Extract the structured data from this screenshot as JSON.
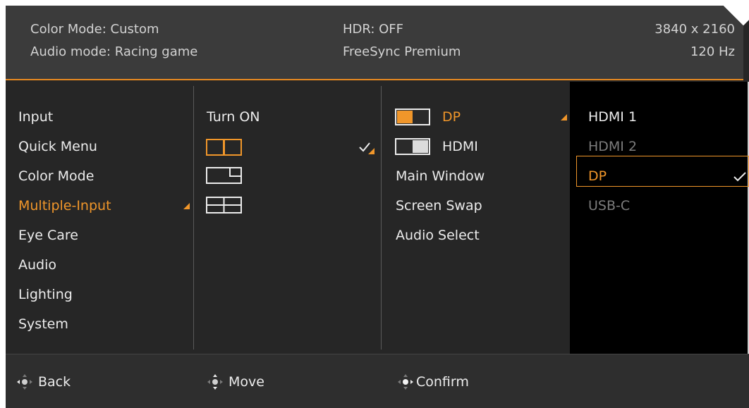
{
  "header": {
    "color_mode": "Color Mode: Custom",
    "audio_mode": "Audio mode: Racing game",
    "hdr": "HDR: OFF",
    "freesync": "FreeSync Premium",
    "resolution": "3840 x 2160",
    "refresh_rate": "120 Hz"
  },
  "menu": {
    "items": [
      {
        "label": "Input"
      },
      {
        "label": "Quick Menu"
      },
      {
        "label": "Color Mode"
      },
      {
        "label": "Multiple-Input",
        "selected": true
      },
      {
        "label": "Eye Care"
      },
      {
        "label": "Audio"
      },
      {
        "label": "Lighting"
      },
      {
        "label": "System"
      }
    ]
  },
  "multi_input": {
    "turn_on_label": "Turn ON",
    "layouts": [
      "pbp-side-by-side-icon",
      "pip-corner-icon",
      "quad-split-icon"
    ],
    "selected_layout_index": 0
  },
  "window_settings": {
    "items": [
      {
        "label": "DP",
        "icon": "window-left-active-icon",
        "selected": true
      },
      {
        "label": "HDMI",
        "icon": "window-right-active-icon"
      },
      {
        "label": "Main Window"
      },
      {
        "label": "Screen Swap"
      },
      {
        "label": "Audio Select"
      }
    ]
  },
  "source": {
    "items": [
      {
        "label": "HDMI 1",
        "state": "available"
      },
      {
        "label": "HDMI 2",
        "state": "disabled"
      },
      {
        "label": "DP",
        "state": "selected"
      },
      {
        "label": "USB-C",
        "state": "disabled"
      }
    ]
  },
  "footer": {
    "back": "Back",
    "move": "Move",
    "confirm": "Confirm"
  },
  "colors": {
    "accent": "#f0962a",
    "panel_bg": "#262626",
    "header_bg": "#3b3b3b",
    "source_bg": "#000000"
  }
}
